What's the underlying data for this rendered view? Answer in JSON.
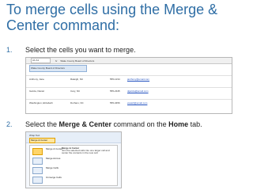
{
  "title": "To merge cells using the Merge & Center command:",
  "steps": [
    {
      "number": "1.",
      "text": "Select the cells you want to merge."
    },
    {
      "number": "2.",
      "prefix": "Select the ",
      "command": "Merge & Center",
      "middle": " command on the ",
      "tab": "Home",
      "suffix": " tab."
    }
  ],
  "sheet": {
    "name_box": "A1:A1",
    "formula": "Wake County Board of Directors",
    "merged_text": "Wake County Board of Directors",
    "rows": [
      [
        "Anthony, Jane",
        "Raleigh, NC",
        "555-1234",
        "janthony@email.com"
      ],
      [
        "Garcia, Daniel",
        "Cary, NC",
        "555-2345",
        "dgarcia@email.com"
      ],
      [
        "Washington, Elizabeth",
        "Durham, NC",
        "555-3456",
        "ewash@email.com"
      ]
    ]
  },
  "ribbon": {
    "wrap_label": "Wrap Text",
    "merge_label": "Merge & Center",
    "dropdown_items": [
      "Merge & Center",
      "Merge Across",
      "Merge Cells",
      "Unmerge Cells"
    ],
    "tooltip_title": "Merge & Center",
    "tooltip_text": "Join the selected cells into one larger cell and center the contents in the new cell."
  }
}
